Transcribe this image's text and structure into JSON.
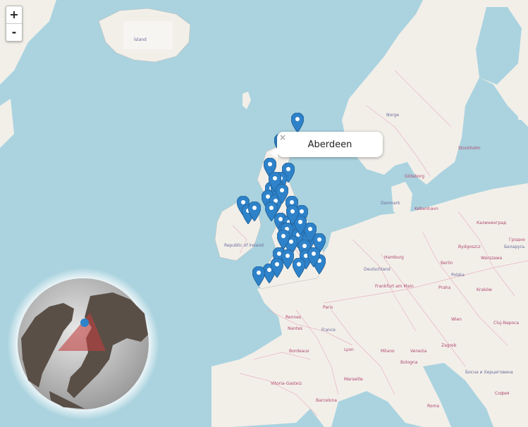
{
  "map": {
    "zoom_in_label": "+",
    "zoom_out_label": "-",
    "popup": {
      "title": "Aberdeen",
      "close_label": "×"
    },
    "marker_color": "#2e82c9",
    "markers": [
      {
        "id": "m1"
      },
      {
        "id": "m2"
      },
      {
        "id": "m3"
      },
      {
        "id": "m4"
      },
      {
        "id": "m5"
      },
      {
        "id": "m6"
      },
      {
        "id": "m7"
      },
      {
        "id": "m8"
      },
      {
        "id": "m9"
      },
      {
        "id": "m10"
      },
      {
        "id": "m11"
      },
      {
        "id": "m12"
      },
      {
        "id": "m13"
      },
      {
        "id": "m14"
      },
      {
        "id": "m15"
      },
      {
        "id": "m16"
      },
      {
        "id": "m17"
      },
      {
        "id": "m18"
      },
      {
        "id": "m19"
      },
      {
        "id": "m20"
      },
      {
        "id": "m21"
      },
      {
        "id": "m22"
      },
      {
        "id": "m23"
      },
      {
        "id": "m24"
      },
      {
        "id": "m25"
      },
      {
        "id": "m26"
      },
      {
        "id": "m27"
      },
      {
        "id": "m28"
      },
      {
        "id": "m29"
      },
      {
        "id": "m30"
      },
      {
        "id": "m31"
      },
      {
        "id": "m32"
      },
      {
        "id": "m33"
      },
      {
        "id": "m34"
      },
      {
        "id": "m35"
      },
      {
        "id": "m36"
      },
      {
        "id": "m37"
      },
      {
        "id": "m38"
      },
      {
        "id": "m39"
      },
      {
        "id": "m40"
      }
    ],
    "labels": {
      "iceland": "Ísland",
      "ireland": "Republic of Ireland",
      "norway": "Norge",
      "stockholm": "Stockholm",
      "goteborg": "Göteborg",
      "danmark": "Danmark",
      "kobenhavn": "København",
      "hamburg": "Hamburg",
      "berlin": "Berlin",
      "deutschland": "Deutschland",
      "frankfurt": "Frankfurt am Main",
      "praha": "Praha",
      "paris": "Paris",
      "rennes": "Rennes",
      "nantes": "Nantes",
      "france": "France",
      "lyon": "Lyon",
      "bordeaux": "Bordeaux",
      "marseille": "Marseille",
      "milano": "Milano",
      "venezia": "Venezia",
      "bologna": "Bologna",
      "zagreb": "Zagreb",
      "wien": "Wien",
      "krakow": "Kraków",
      "warszawa": "Warszawa",
      "polska": "Polska",
      "bydgoszcz": "Bydgoszcz",
      "kaliningrad": "Калининград",
      "grodno": "Гродно",
      "vitoria": "Vitoria-Gasteiz",
      "barcelona": "Barcelona",
      "roma": "Roma",
      "bosna": "Босна и Херцеговина",
      "sofia": "София",
      "cluj": "Cluj-Napoca",
      "belarus": "Беларусь"
    }
  }
}
